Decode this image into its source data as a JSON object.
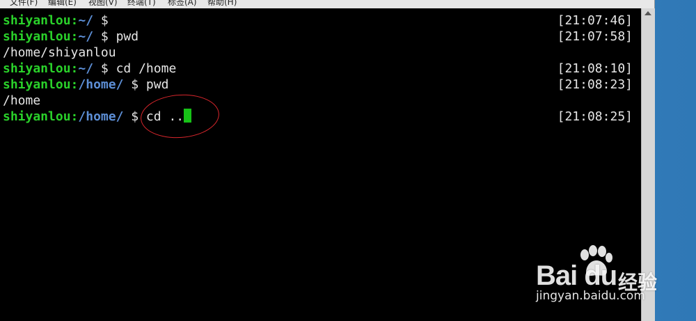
{
  "menubar": {
    "items": [
      "文件(F)",
      "编辑(E)",
      "视图(V)",
      "终端(T)",
      "标签(A)",
      "帮助(H)"
    ]
  },
  "terminal": {
    "lines": [
      {
        "user": "shiyanlou",
        "sep": ":",
        "path": "~/",
        "cmd": " $ ",
        "timestamp": "[21:07:46]"
      },
      {
        "user": "shiyanlou",
        "sep": ":",
        "path": "~/",
        "cmd": " $ pwd",
        "timestamp": "[21:07:58]"
      },
      {
        "output": "/home/shiyanlou"
      },
      {
        "user": "shiyanlou",
        "sep": ":",
        "path": "~/",
        "cmd": " $ cd /home",
        "timestamp": "[21:08:10]"
      },
      {
        "user": "shiyanlou",
        "sep": ":",
        "path": "/home/",
        "cmd": " $ pwd",
        "timestamp": "[21:08:23]"
      },
      {
        "output": "/home"
      },
      {
        "user": "shiyanlou",
        "sep": ":",
        "path": "/home/",
        "cmd": " $ cd ..",
        "timestamp": "[21:08:25]"
      }
    ]
  },
  "colors": {
    "terminal_bg": "#000000",
    "user_prompt": "#2ad12a",
    "path_prompt": "#5d8fd6",
    "cursor": "#17c217",
    "annotation": "#d8262c"
  },
  "watermark": {
    "logo": "Bai du",
    "cn": "经验",
    "url": "jingyan.baidu.com"
  }
}
